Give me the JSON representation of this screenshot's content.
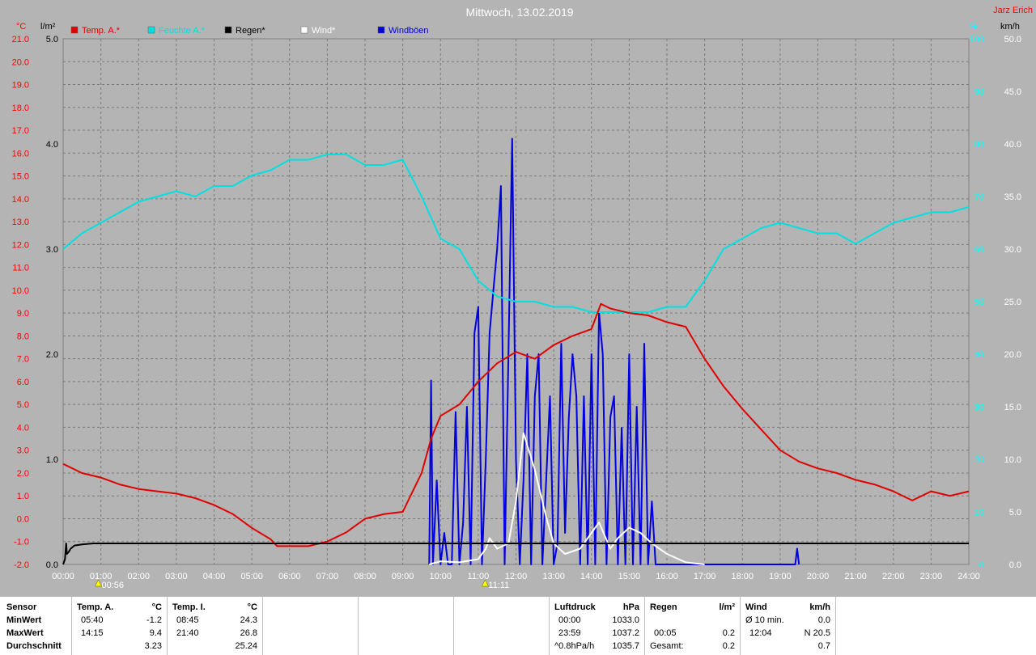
{
  "title": "Mittwoch, 13.02.2019",
  "author": "Jarz Erich",
  "axes": {
    "left_temp_unit": "°C",
    "left_rain_unit": "l/m²",
    "right_hum_unit": "%",
    "right_wind_unit": "km/h"
  },
  "legend": [
    {
      "name": "Temp. A.*",
      "color": "#e00000"
    },
    {
      "name": "Feuchte A.*",
      "color": "#00e0e0"
    },
    {
      "name": "Regen*",
      "color": "#000000"
    },
    {
      "name": "Wind*",
      "color": "#ffffff"
    },
    {
      "name": "Windböen",
      "color": "#0000e0"
    }
  ],
  "markers": [
    {
      "label": "00:56",
      "x": 0.933
    },
    {
      "label": "11:11",
      "x": 11.183
    }
  ],
  "chart_data": {
    "type": "line",
    "x_unit": "hours",
    "xlim": [
      0,
      24
    ],
    "x_ticks": [
      "00:00",
      "01:00",
      "02:00",
      "03:00",
      "04:00",
      "05:00",
      "06:00",
      "07:00",
      "08:00",
      "09:00",
      "10:00",
      "11:00",
      "12:00",
      "13:00",
      "14:00",
      "15:00",
      "16:00",
      "17:00",
      "18:00",
      "19:00",
      "20:00",
      "21:00",
      "22:00",
      "23:00",
      "24:00"
    ],
    "temp_axis": {
      "ylim": [
        -2.0,
        21.0
      ],
      "ticks": [
        "-2.0",
        "-1.0",
        "0.0",
        "1.0",
        "2.0",
        "3.0",
        "4.0",
        "5.0",
        "6.0",
        "7.0",
        "8.0",
        "9.0",
        "10.0",
        "11.0",
        "12.0",
        "13.0",
        "14.0",
        "15.0",
        "16.0",
        "17.0",
        "18.0",
        "19.0",
        "20.0",
        "21.0"
      ]
    },
    "rain_axis": {
      "ylim": [
        0.0,
        5.0
      ],
      "ticks": [
        "0.0",
        "1.0",
        "2.0",
        "3.0",
        "4.0",
        "5.0"
      ]
    },
    "hum_axis": {
      "ylim": [
        0,
        100
      ],
      "ticks": [
        "0",
        "10",
        "20",
        "30",
        "40",
        "50",
        "60",
        "70",
        "80",
        "90",
        "100"
      ]
    },
    "wind_axis": {
      "ylim": [
        0.0,
        50.0
      ],
      "ticks": [
        "0.0",
        "5.0",
        "10.0",
        "15.0",
        "20.0",
        "25.0",
        "30.0",
        "35.0",
        "40.0",
        "45.0",
        "50.0"
      ]
    },
    "series": [
      {
        "name": "Temp. A.*",
        "axis": "temp",
        "color": "#e00000",
        "x": [
          0,
          0.5,
          1,
          1.5,
          2,
          2.5,
          3,
          3.5,
          4,
          4.5,
          5,
          5.5,
          5.67,
          6,
          6.5,
          7,
          7.5,
          8,
          8.5,
          9,
          9.5,
          9.75,
          10,
          10.5,
          11,
          11.5,
          12,
          12.5,
          13,
          13.5,
          14,
          14.25,
          14.5,
          15,
          15.5,
          16,
          16.5,
          17,
          17.5,
          18,
          18.5,
          19,
          19.5,
          20,
          20.5,
          21,
          21.5,
          22,
          22.5,
          23,
          23.5,
          24
        ],
        "y": [
          2.4,
          2.0,
          1.8,
          1.5,
          1.3,
          1.2,
          1.1,
          0.9,
          0.6,
          0.2,
          -0.4,
          -0.9,
          -1.2,
          -1.2,
          -1.2,
          -1.0,
          -0.6,
          0.0,
          0.2,
          0.3,
          2.0,
          3.5,
          4.5,
          5.0,
          6.0,
          6.8,
          7.3,
          7.0,
          7.6,
          8.0,
          8.3,
          9.4,
          9.2,
          9.0,
          8.9,
          8.6,
          8.4,
          7.0,
          5.8,
          4.8,
          3.9,
          3.0,
          2.5,
          2.2,
          2.0,
          1.7,
          1.5,
          1.2,
          0.8,
          1.2,
          1.0,
          1.2
        ]
      },
      {
        "name": "Feuchte A.*",
        "axis": "hum",
        "color": "#00e0e0",
        "x": [
          0,
          0.5,
          1,
          1.5,
          2,
          2.5,
          3,
          3.5,
          4,
          4.5,
          5,
          5.5,
          6,
          6.5,
          7,
          7.5,
          8,
          8.5,
          9,
          9.5,
          10,
          10.5,
          11,
          11.5,
          12,
          12.5,
          13,
          13.5,
          14,
          14.5,
          15,
          15.5,
          16,
          16.5,
          17,
          17.5,
          18,
          18.5,
          19,
          19.5,
          20,
          20.5,
          21,
          21.5,
          22,
          22.5,
          23,
          23.5,
          24
        ],
        "y": [
          60,
          63,
          65,
          67,
          69,
          70,
          71,
          70,
          72,
          72,
          74,
          75,
          77,
          77,
          78,
          78,
          76,
          76,
          77,
          70,
          62,
          60,
          54,
          51,
          50,
          50,
          49,
          49,
          48,
          48,
          48,
          48,
          49,
          49,
          54,
          60,
          62,
          64,
          65,
          64,
          63,
          63,
          61,
          63,
          65,
          66,
          67,
          67,
          68
        ]
      },
      {
        "name": "Regen*",
        "axis": "rain",
        "color": "#000000",
        "x": [
          0,
          0.05,
          0.08,
          0.1,
          0.15,
          0.2,
          0.3,
          0.5,
          0.8,
          1.0,
          24
        ],
        "y": [
          0,
          0.05,
          0.2,
          0.1,
          0.12,
          0.15,
          0.18,
          0.19,
          0.2,
          0.2,
          0.2
        ]
      },
      {
        "name": "Wind*",
        "axis": "wind",
        "color": "#ffffff",
        "x": [
          9.7,
          10,
          10.5,
          11,
          11.2,
          11.3,
          11.5,
          11.8,
          12,
          12.2,
          12.5,
          12.8,
          13,
          13.3,
          13.7,
          14,
          14.2,
          14.5,
          14.7,
          15,
          15.3,
          15.6,
          16,
          16.5,
          17
        ],
        "y": [
          0,
          0.3,
          0.2,
          0.5,
          1.5,
          2.5,
          1.5,
          2.0,
          6.0,
          12.5,
          9.0,
          4.5,
          2.0,
          1.0,
          1.5,
          3.0,
          4.0,
          1.5,
          2.5,
          3.5,
          3.0,
          2.0,
          1.0,
          0.2,
          0
        ]
      },
      {
        "name": "Windböen",
        "axis": "wind",
        "color": "#0000e0",
        "x": [
          9.7,
          9.75,
          9.8,
          9.9,
          10.0,
          10.1,
          10.2,
          10.3,
          10.4,
          10.5,
          10.6,
          10.7,
          10.8,
          10.9,
          11.0,
          11.1,
          11.2,
          11.3,
          11.4,
          11.5,
          11.6,
          11.7,
          11.8,
          11.9,
          12.0,
          12.1,
          12.2,
          12.3,
          12.4,
          12.5,
          12.6,
          12.7,
          12.8,
          12.9,
          13.0,
          13.1,
          13.2,
          13.3,
          13.4,
          13.5,
          13.6,
          13.7,
          13.8,
          13.9,
          14.0,
          14.1,
          14.2,
          14.3,
          14.4,
          14.5,
          14.6,
          14.7,
          14.8,
          14.9,
          15.0,
          15.1,
          15.2,
          15.3,
          15.4,
          15.5,
          15.6,
          15.7,
          15.8,
          15.9,
          16.0,
          16.1,
          16.2,
          19.4,
          19.45,
          19.5
        ],
        "y": [
          0,
          17.5,
          0,
          8,
          0,
          3,
          0,
          0,
          14.5,
          0,
          4,
          15,
          0,
          22,
          24.5,
          0,
          10,
          22,
          26,
          30,
          36,
          0,
          20,
          40.5,
          10,
          0,
          8,
          20,
          0,
          16,
          20,
          0,
          8,
          16,
          0,
          2,
          21,
          3,
          14,
          20,
          16,
          0,
          16,
          0,
          20,
          0,
          24,
          20,
          0,
          14,
          16,
          0,
          13,
          0,
          20,
          0,
          15,
          0,
          21,
          0,
          6,
          0,
          0,
          0,
          0,
          0,
          0,
          0,
          1.5,
          0
        ]
      }
    ]
  },
  "table": {
    "sensor": {
      "title": "Sensor",
      "rows": [
        "MinWert",
        "MaxWert",
        "Durchschnitt"
      ]
    },
    "temp_a": {
      "title": "Temp. A.",
      "unit": "°C",
      "times": [
        "05:40",
        "14:15",
        ""
      ],
      "values": [
        "-1.2",
        "9.4",
        "3.23"
      ]
    },
    "temp_i": {
      "title": "Temp. I.",
      "unit": "°C",
      "times": [
        "08:45",
        "21:40",
        ""
      ],
      "values": [
        "24.3",
        "26.8",
        "25.24"
      ]
    },
    "luft": {
      "title": "Luftdruck",
      "unit": "hPa",
      "times": [
        "00:00",
        "23:59",
        "^0.8hPa/h"
      ],
      "values": [
        "1033.0",
        "1037.2",
        "1035.7"
      ]
    },
    "regen": {
      "title": "Regen",
      "unit": "l/m²",
      "times": [
        "",
        "00:05",
        "Gesamt:"
      ],
      "values": [
        "",
        "0.2",
        "0.2"
      ]
    },
    "wind": {
      "title": "Wind",
      "unit": "km/h",
      "times": [
        "Ø 10 min.",
        "12:04",
        ""
      ],
      "values": [
        "0.0",
        "N 20.5",
        "0.7"
      ]
    }
  }
}
